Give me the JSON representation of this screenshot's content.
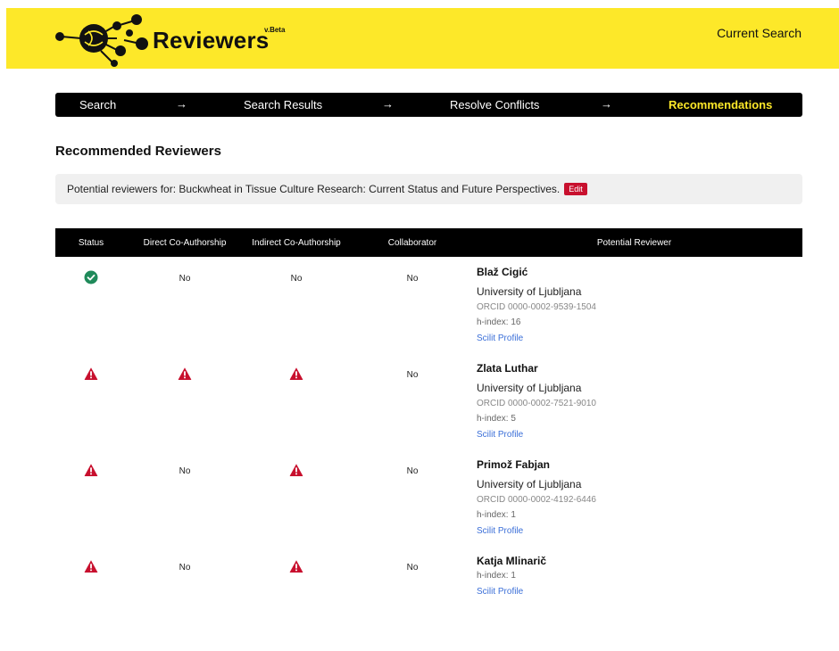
{
  "app": {
    "title": "Reviewers",
    "version": "v.Beta",
    "nav_current_search": "Current Search"
  },
  "steps": [
    {
      "label": "Search",
      "active": false
    },
    {
      "label": "Search Results",
      "active": false
    },
    {
      "label": "Resolve Conflicts",
      "active": false
    },
    {
      "label": "Recommendations",
      "active": true
    }
  ],
  "arrow": "→",
  "page": {
    "title": "Recommended Reviewers",
    "info_text": "Potential reviewers for: Buckwheat in Tissue Culture Research: Current Status and Future Perspectives.",
    "edit_label": "Edit"
  },
  "table": {
    "headers": [
      "Status",
      "Direct Co-Authorship",
      "Indirect Co-Authorship",
      "Collaborator",
      "Potential Reviewer"
    ],
    "rows": [
      {
        "status": "check-icon",
        "direct": "No",
        "indirect": "No",
        "collaborator": "No",
        "name": "Blaž Cigić",
        "affiliation": "University of Ljubljana",
        "orcid": "ORCID 0000-0002-9539-1504",
        "hindex": "h-index: 16",
        "profile": "Scilit Profile"
      },
      {
        "status": "warning-icon",
        "direct": "warning-icon",
        "indirect": "warning-icon",
        "collaborator": "No",
        "name": "Zlata Luthar",
        "affiliation": "University of Ljubljana",
        "orcid": "ORCID 0000-0002-7521-9010",
        "hindex": "h-index: 5",
        "profile": "Scilit Profile"
      },
      {
        "status": "warning-icon",
        "direct": "No",
        "indirect": "warning-icon",
        "collaborator": "No",
        "name": "Primož Fabjan",
        "affiliation": "University of Ljubljana",
        "orcid": "ORCID 0000-0002-4192-6446",
        "hindex": "h-index: 1",
        "profile": "Scilit Profile"
      },
      {
        "status": "warning-icon",
        "direct": "No",
        "indirect": "warning-icon",
        "collaborator": "No",
        "name": "Katja Mlinarič",
        "affiliation": "",
        "orcid": "",
        "hindex": "h-index: 1",
        "profile": "Scilit Profile"
      }
    ]
  },
  "colors": {
    "brand_yellow": "#fde829",
    "success_green": "#1f8a5a",
    "warning_red": "#c8102e",
    "link_blue": "#3b6fd8"
  }
}
